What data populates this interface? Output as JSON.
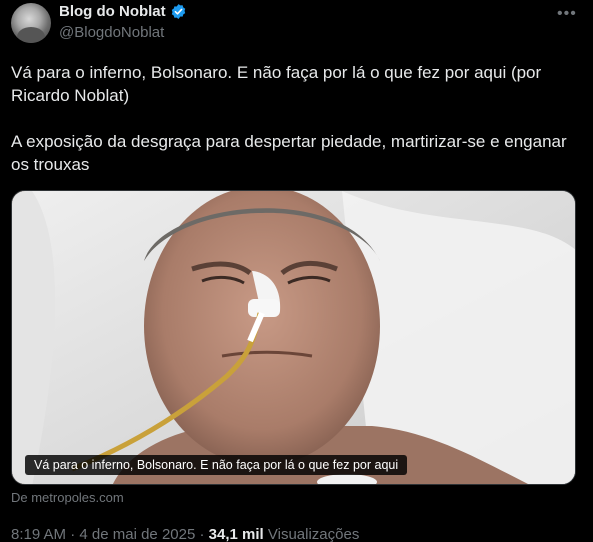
{
  "author": {
    "name": "Blog do Noblat",
    "handle": "@BlogdoNoblat"
  },
  "tweet": {
    "line1": "Vá para o inferno, Bolsonaro. E não faça por lá o que fez por aqui (por Ricardo Noblat)",
    "line2": "A exposição da desgraça para despertar piedade, martirizar-se e enganar os trouxas"
  },
  "media": {
    "caption": "Vá para o inferno, Bolsonaro. E não faça por lá o que fez por aqui",
    "source": "De metropoles.com"
  },
  "meta": {
    "time": "8:19 AM",
    "separator": "·",
    "date": "4 de mai de 2025",
    "views_count": "34,1 mil",
    "views_label": "Visualizações"
  },
  "icons": {
    "verified": "verified-badge-icon",
    "more": "more-options-icon"
  },
  "colors": {
    "background": "#000000",
    "text": "#e7e9ea",
    "secondary": "#71767b",
    "verified": "#1d9bf0"
  }
}
